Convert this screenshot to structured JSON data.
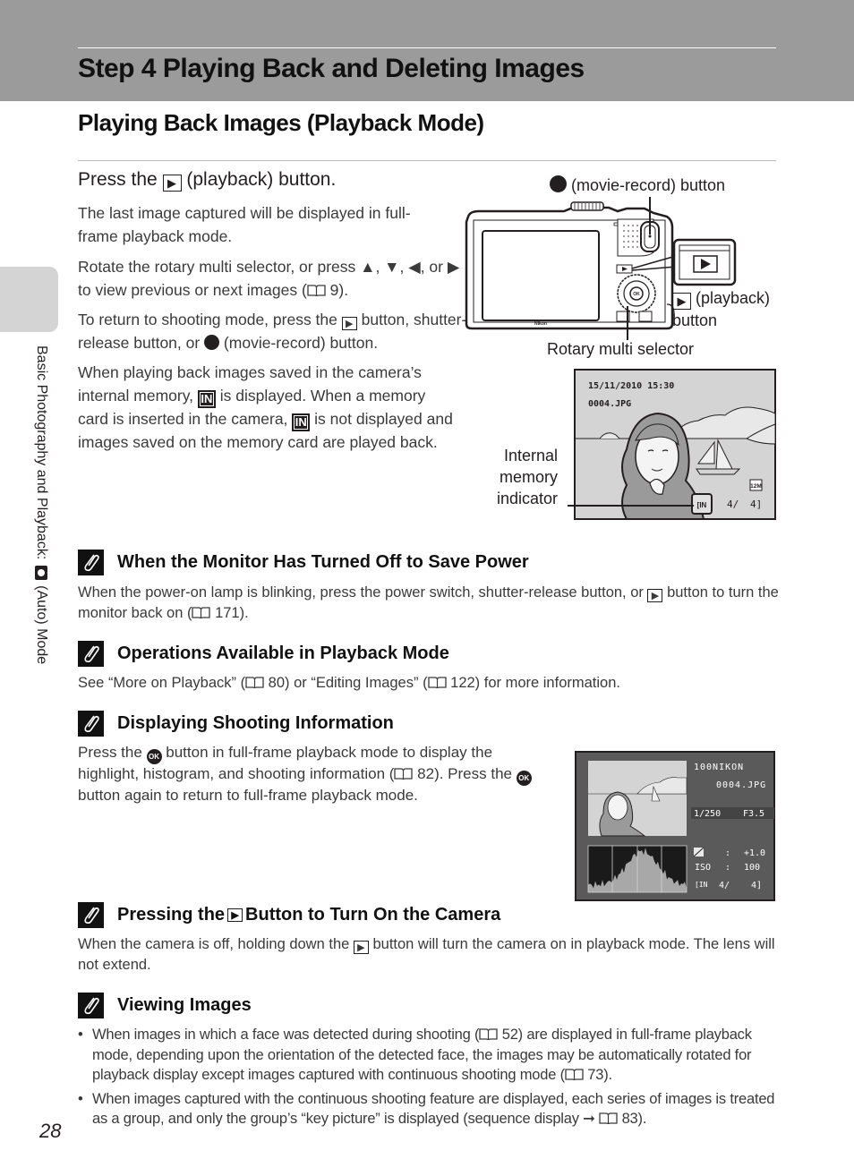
{
  "header": {
    "chapter_title": "Step 4 Playing Back and Deleting Images",
    "section_title": "Playing Back Images (Playback Mode)"
  },
  "side_tab": {
    "label_before": "Basic Photography and Playback: ",
    "label_after": " (Auto) Mode",
    "icon": "camera-icon"
  },
  "step": {
    "head_before": "Press the ",
    "head_after": " (playback) button.",
    "icon": "playback-icon",
    "paragraphs": {
      "p1": "The last image captured will be displayed in full-frame playback mode.",
      "p2_a": "Rotate the rotary multi selector, or press ",
      "p2_b": " to view previous or next images (",
      "p2_c": " 9).",
      "p3_a": "To return to shooting mode, press the ",
      "p3_b": " button, shutter-release button, or ",
      "p3_c": " (movie-record) button.",
      "p4_a": "When playing back images saved in the camera’s internal memory, ",
      "p4_b": " is displayed. When a memory card is inserted in the camera, ",
      "p4_c": " is not displayed and images saved on the memory card are played back."
    },
    "arrows": "▲, ▼, ◀, or ▶",
    "in_icon_label": "IN"
  },
  "camera_diagram": {
    "movie_record_label": " (movie-record) button",
    "playback_label_a": " (playback)",
    "playback_label_b": "button",
    "rotary_label": "Rotary multi selector",
    "brand": "Nikon",
    "ok_label": "OK"
  },
  "playback_screen": {
    "datetime": "15/11/2010 15:30",
    "filename": "0004.JPG",
    "counter_current": "4/",
    "counter_total": "4]",
    "image_size_icon": "12M",
    "internal_memory_label": [
      "Internal",
      "memory",
      "indicator"
    ]
  },
  "notes": [
    {
      "title": "When the Monitor Has Turned Off to Save Power",
      "body_a": "When the power-on lamp is blinking, press the power switch, shutter-release button, or ",
      "body_b": " button to turn the monitor back on (",
      "body_c": " 171)."
    },
    {
      "title": "Operations Available in Playback Mode",
      "body_a": "See “More on Playback” (",
      "body_b": " 80) or “Editing Images” (",
      "body_c": " 122) for more information."
    },
    {
      "title": "Displaying Shooting Information",
      "body_a": "Press the ",
      "body_b": " button in full-frame playback mode to display the highlight, histogram, and shooting information (",
      "body_c": " 82). Press the ",
      "body_d": " button again to return to full-frame playback mode."
    },
    {
      "title_a": "Pressing the ",
      "title_b": " Button to Turn On the Camera",
      "body_a": "When the camera is off, holding down the ",
      "body_b": " button will turn the camera on in playback mode. The lens will not extend."
    },
    {
      "title": "Viewing Images",
      "bullets": [
        {
          "a": "When images in which a face was detected during shooting (",
          "b": " 52) are displayed in full-frame playback mode, depending upon the orientation of the detected face, the images may be automatically rotated for playback display except images captured with continuous shooting mode (",
          "c": " 73)."
        },
        {
          "a": "When images captured with the continuous shooting feature are displayed, each series of images is treated as a group, and only the group’s “key picture” is displayed (sequence display ➞ ",
          "b": " 83)."
        }
      ]
    }
  ],
  "info_screen": {
    "folder": "100NIKON",
    "filename": "0004.JPG",
    "shutter": "1/250",
    "aperture": "F3.5",
    "exposure_comp": "+1.0",
    "iso_label": "ISO",
    "iso": "100",
    "separator": ":",
    "counter_current": "4/",
    "counter_total": "4]"
  },
  "page_number": "28"
}
